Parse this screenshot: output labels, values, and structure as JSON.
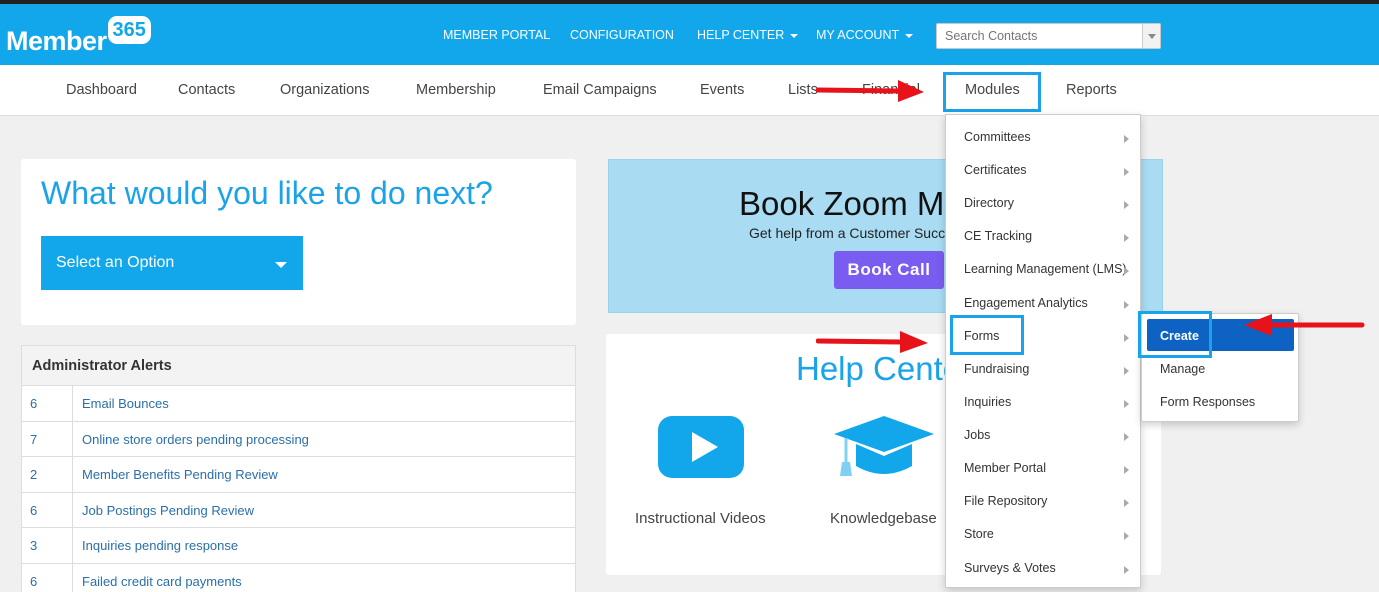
{
  "logo": {
    "text": "Member",
    "badge": "365"
  },
  "topnav": {
    "member_portal": "MEMBER PORTAL",
    "configuration": "CONFIGURATION",
    "help_center": "HELP CENTER",
    "my_account": "MY ACCOUNT",
    "search_placeholder": "Search Contacts"
  },
  "mainnav": {
    "items": [
      "Dashboard",
      "Contacts",
      "Organizations",
      "Membership",
      "Email Campaigns",
      "Events",
      "Lists",
      "Financial",
      "Modules",
      "Reports"
    ]
  },
  "next": {
    "title": "What would you like to do next?",
    "select_label": "Select an Option"
  },
  "alerts": {
    "title": "Administrator Alerts",
    "rows": [
      {
        "count": "6",
        "text": "Email Bounces"
      },
      {
        "count": "7",
        "text": "Online store orders pending processing"
      },
      {
        "count": "2",
        "text": "Member Benefits Pending Review"
      },
      {
        "count": "6",
        "text": "Job Postings Pending Review"
      },
      {
        "count": "3",
        "text": "Inquiries pending response"
      },
      {
        "count": "6",
        "text": "Failed credit card payments"
      }
    ]
  },
  "zoom": {
    "title": "Book Zoom Meeting",
    "subtitle": "Get help from a Customer Success",
    "button": "Book Call"
  },
  "help": {
    "title": "Help Center",
    "videos": "Instructional Videos",
    "knowledgebase": "Knowledgebase"
  },
  "modules_menu": {
    "items": [
      "Committees",
      "Certificates",
      "Directory",
      "CE Tracking",
      "Learning Management (LMS)",
      "Engagement Analytics",
      "Forms",
      "Fundraising",
      "Inquiries",
      "Jobs",
      "Member Portal",
      "File Repository",
      "Store",
      "Surveys & Votes"
    ]
  },
  "forms_menu": {
    "create": "Create",
    "manage": "Manage",
    "responses": "Form Responses"
  },
  "colors": {
    "brand_blue": "#12a7ea",
    "highlight_box": "#1aa3e8",
    "annotation_arrow": "#e8121a",
    "zoom_button": "#7a5cf0",
    "create_active": "#0d62c4"
  }
}
